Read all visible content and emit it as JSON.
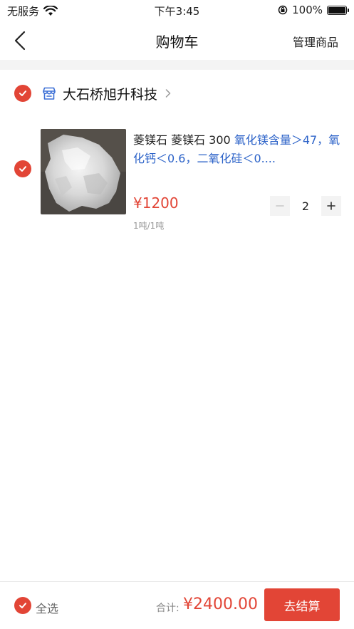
{
  "status_bar": {
    "carrier": "无服务",
    "time": "下午3:45",
    "battery": "100%",
    "battery_level": 1.0
  },
  "nav": {
    "title": "购物车",
    "manage_label": "管理商品"
  },
  "store": {
    "name": "大石桥旭升科技",
    "checked": true
  },
  "items": [
    {
      "title": "菱镁石 菱镁石 300 ",
      "spec": "氧化镁含量＞47，氧化钙＜0.6，二氧化硅＜0....",
      "price": "¥1200",
      "unit": "1吨/1吨",
      "quantity": "2",
      "checked": true
    }
  ],
  "footer": {
    "select_all_label": "全选",
    "total_label": "合计:",
    "total_value": "¥2400.00",
    "checkout_label": "去结算"
  },
  "colors": {
    "accent": "#e24536",
    "spec_text": "#2b62c8"
  },
  "icons": [
    "wifi-icon",
    "lock-rotation-icon",
    "battery-icon",
    "back-arrow-icon",
    "check-icon",
    "store-icon",
    "chevron-right-icon",
    "minus-icon",
    "plus-icon"
  ]
}
